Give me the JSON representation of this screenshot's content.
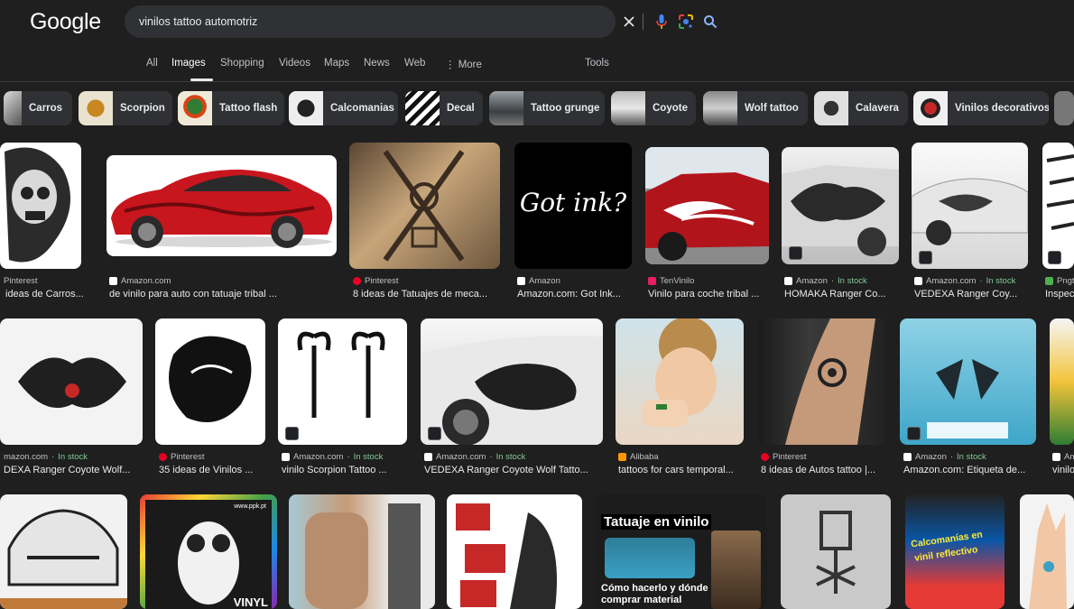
{
  "header": {
    "logo": "Google",
    "query": "vinilos tattoo automotriz"
  },
  "tabs": [
    "All",
    "Images",
    "Shopping",
    "Videos",
    "Maps",
    "News",
    "Web",
    "⋮ More",
    "Tools"
  ],
  "chips": [
    "Carros",
    "Scorpion",
    "Tattoo flash",
    "Calcomanias",
    "Decal",
    "Tattoo grunge",
    "Coyote",
    "Wolf tattoo",
    "Calavera",
    "Vinilos decorativos"
  ],
  "row1": [
    {
      "source": "Pinterest",
      "stock": "",
      "caption": "ideas de Carros..."
    },
    {
      "source": "Amazon.com",
      "stock": "",
      "caption": "de vinilo para auto con tatuaje tribal ..."
    },
    {
      "source": "Pinterest",
      "stock": "",
      "caption": "8 ideas de Tatuajes de meca..."
    },
    {
      "source": "Amazon",
      "stock": "",
      "caption": "Amazon.com: Got Ink..."
    },
    {
      "source": "TenVinilo",
      "stock": "",
      "caption": "Vinilo para coche tribal ..."
    },
    {
      "source": "Amazon",
      "stock": "In stock",
      "caption": "HOMAKA Ranger Co..."
    },
    {
      "source": "Amazon.com",
      "stock": "In stock",
      "caption": "VEDEXA Ranger Coy..."
    },
    {
      "source": "Pngt",
      "stock": "",
      "caption": "Inspec"
    }
  ],
  "row2": [
    {
      "source": "mazon.com",
      "stock": "In stock",
      "caption": "DEXA Ranger Coyote Wolf..."
    },
    {
      "source": "Pinterest",
      "stock": "",
      "caption": "35 ideas de Vinilos ..."
    },
    {
      "source": "Amazon.com",
      "stock": "In stock",
      "caption": "vinilo Scorpion Tattoo ..."
    },
    {
      "source": "Amazon.com",
      "stock": "In stock",
      "caption": "VEDEXA Ranger Coyote Wolf Tatto..."
    },
    {
      "source": "Alibaba",
      "stock": "",
      "caption": "tattoos for cars temporal..."
    },
    {
      "source": "Pinterest",
      "stock": "",
      "caption": "8 ideas de Autos tattoo |..."
    },
    {
      "source": "Amazon",
      "stock": "In stock",
      "caption": "Amazon.com: Etiqueta de..."
    },
    {
      "source": "Am",
      "stock": "",
      "caption": "vinilo"
    }
  ],
  "images": {
    "got_ink": "Got ink?",
    "vinyl": "VINYL",
    "ppk": "www.ppk.pt",
    "tatuaje_title": "Tatuaje en vinilo",
    "tatuaje_sub1": "Cómo hacerlo y dónde",
    "tatuaje_sub2": "comprar material",
    "calco_line1": "Calcomanías en",
    "calco_line2": "vinil reflectivo"
  },
  "colors": {
    "background": "#1f1f1f",
    "search_bg": "#303134",
    "chip_bg": "#303134",
    "in_stock": "#81c995",
    "pinterest": "#e60023",
    "amazon": "#ffffff",
    "tenvinilo": "#e91e63",
    "alibaba": "#ff9800"
  }
}
